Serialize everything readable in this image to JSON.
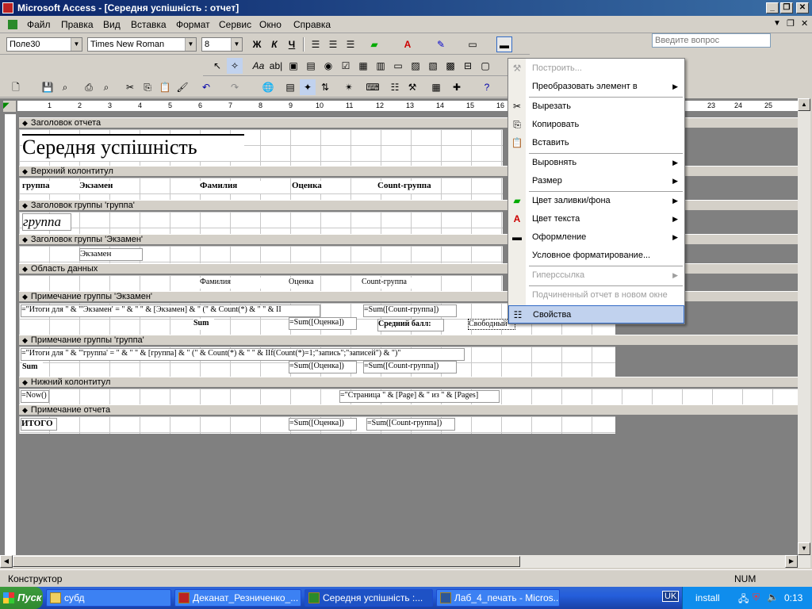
{
  "window": {
    "title": "Microsoft Access - [Середня успішність : отчет]"
  },
  "menu": [
    "Файл",
    "Правка",
    "Вид",
    "Вставка",
    "Формат",
    "Сервис",
    "Окно",
    "Справка"
  ],
  "ask_placeholder": "Введите вопрос",
  "format_bar": {
    "control": "Поле30",
    "font": "Times New Roman",
    "size": "8",
    "bold": "Ж",
    "italic": "К",
    "underline": "Ч"
  },
  "sections": {
    "report_header": "Заголовок отчета",
    "page_header": "Верхний колонтитул",
    "group_header_group": "Заголовок группы 'группа'",
    "group_header_exam": "Заголовок группы 'Экзамен'",
    "detail": "Область данных",
    "group_footer_exam": "Примечание группы 'Экзамен'",
    "group_footer_group": "Примечание группы 'группа'",
    "page_footer": "Нижний колонтитул",
    "report_footer": "Примечание отчета"
  },
  "controls": {
    "title": "Середня успішність",
    "ph_group": "группа",
    "ph_exam": "Экзамен",
    "ph_surname": "Фамилия",
    "ph_grade": "Оценка",
    "ph_count": "Count-группа",
    "gh_group": "группа",
    "gh_exam": "Экзамен",
    "d_surname": "Фамилия",
    "d_grade": "Оценка",
    "d_count": "Count-группа",
    "gf_exam_expr": "=\"Итоги для \" & \"'Экзамен' = \" & \" \" & [Экзамен] & \" (\" & Count(*) & \" \" & II",
    "gf_exam_sum_count": "=Sum([Count-группа])",
    "gf_exam_sum": "Sum",
    "gf_exam_sum_grade": "=Sum([Оценка])",
    "gf_exam_avg": "Средний балл:",
    "gf_exam_free": "Свободный",
    "gf_group_expr": "=\"Итоги для \" & \"'группа' = \" & \" \" & [группа] & \" (\" & Count(*) & \" \" & IIf(Count(*)=1;\"запись\";\"записей\") & \")\"",
    "gf_group_sum": "Sum",
    "gf_group_sum_grade": "=Sum([Оценка])",
    "gf_group_sum_count": "=Sum([Count-группа])",
    "pf_now": "=Now()",
    "pf_page": "=\"Страница \" & [Page] & \" из \" & [Pages]",
    "rf_total": "ИТОГО",
    "rf_sum_grade": "=Sum([Оценка])",
    "rf_sum_count": "=Sum([Count-группа])"
  },
  "ruler": [
    "1",
    "2",
    "3",
    "4",
    "5",
    "6",
    "7",
    "8",
    "9",
    "10",
    "11",
    "12",
    "13",
    "14",
    "15",
    "16",
    "23",
    "24",
    "25"
  ],
  "context_menu": [
    {
      "label": "Построить...",
      "disabled": true,
      "icon": "build-icon"
    },
    {
      "label": "Преобразовать элемент в",
      "submenu": true
    },
    {
      "label": "Вырезать",
      "icon": "cut-icon"
    },
    {
      "label": "Копировать",
      "icon": "copy-icon"
    },
    {
      "label": "Вставить",
      "icon": "paste-icon"
    },
    {
      "label": "Выровнять",
      "submenu": true
    },
    {
      "label": "Размер",
      "submenu": true
    },
    {
      "label": "Цвет заливки/фона",
      "submenu": true,
      "icon": "fill-color-icon"
    },
    {
      "label": "Цвет текста",
      "submenu": true,
      "icon": "font-color-icon"
    },
    {
      "label": "Оформление",
      "submenu": true,
      "icon": "special-effect-icon"
    },
    {
      "label": "Условное форматирование..."
    },
    {
      "label": "Гиперссылка",
      "disabled": true,
      "submenu": true
    },
    {
      "label": "Подчиненный отчет в новом окне",
      "disabled": true
    },
    {
      "label": "Свойства",
      "selected": true,
      "icon": "properties-icon"
    }
  ],
  "status": {
    "mode": "Конструктор",
    "num": "NUM"
  },
  "taskbar": {
    "start": "Пуск",
    "tasks": [
      "субд",
      "Деканат_Резниченко_...",
      "Середня успішність :...",
      "Лаб_4_печать - Micros..."
    ],
    "lang": "UK",
    "user": "install",
    "time": "0:13"
  }
}
